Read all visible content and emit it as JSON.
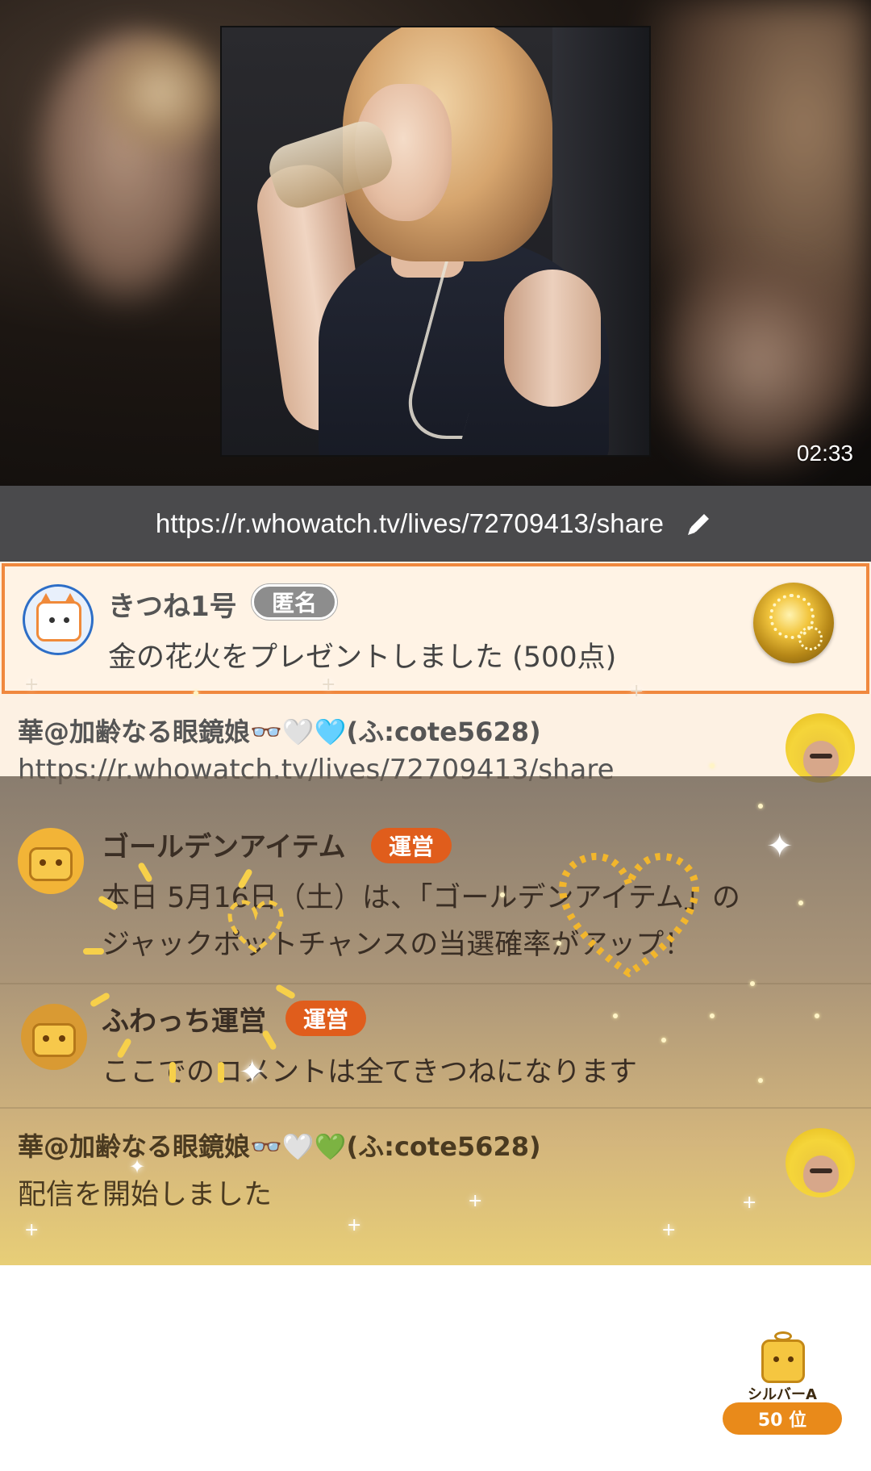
{
  "video": {
    "timer": "02:33"
  },
  "share": {
    "url": "https://r.whowatch.tv/lives/72709413/share",
    "edit_icon": "pencil-icon"
  },
  "comments": [
    {
      "type": "gift",
      "user": "きつね1号",
      "badge": "匿名",
      "message": "金の花火をプレゼントしました (500点)",
      "gift_icon": "gold-fireworks-icon",
      "highlight_color": "#f0883e"
    },
    {
      "type": "comment",
      "user": "華@加齢なる眼鏡娘👓🤍🩵(ふ:cote5628)",
      "message": "https://r.whowatch.tv/lives/72709413/share"
    },
    {
      "type": "staff",
      "user": "ゴールデンアイテム",
      "badge": "運営",
      "message_line1": "本日 5月16日（土）は、「ゴールデンアイテム」の",
      "message_line2": "ジャックポットチャンスの当選確率がアップ！"
    },
    {
      "type": "staff",
      "user": "ふわっち運営",
      "badge": "運営",
      "message": "ここでのコメントは全てきつねになります"
    },
    {
      "type": "comment",
      "user": "華@加齢なる眼鏡娘👓🤍💚(ふ:cote5628)",
      "message": "配信を開始しました"
    }
  ],
  "rank": {
    "label": "シルバーA",
    "position": "50 位"
  },
  "colors": {
    "share_bar": "#4a4a4c",
    "staff_badge": "#e05d1c",
    "anon_badge": "#8d8d8d",
    "rank_pill": "#e98a1a"
  }
}
